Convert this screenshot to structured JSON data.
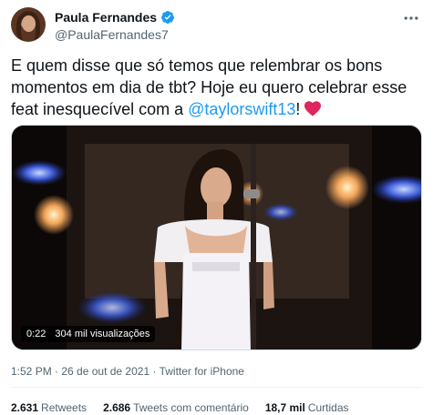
{
  "author": {
    "display_name": "Paula Fernandes",
    "handle": "@PaulaFernandes7",
    "verified": true,
    "avatar_icon": "avatar-photo"
  },
  "tweet": {
    "line1": "E quem disse que só temos que relembrar os bons",
    "line2": "momentos em dia de tbt? Hoje eu quero celebrar esse",
    "line3_pre": "feat inesquecível com a ",
    "mention": "@taylorswift13",
    "line3_post": "!",
    "emoji": "red-heart"
  },
  "media": {
    "duration": "0:22",
    "views": "304 mil visualizações"
  },
  "meta": {
    "time": "1:52 PM",
    "separator1": " · ",
    "date": "26 de out de 2021",
    "separator2": " · ",
    "source": "Twitter for iPhone"
  },
  "stats": {
    "retweets_count": "2.631",
    "retweets_label": "Retweets",
    "quotes_count": "2.686",
    "quotes_label": "Tweets com comentário",
    "likes_count": "18,7 mil",
    "likes_label": "Curtidas"
  },
  "colors": {
    "link": "#1d9bf0",
    "verified": "#1d9bf0",
    "text": "#0f1419",
    "secondary": "#536471",
    "heart": "#e0245e"
  }
}
